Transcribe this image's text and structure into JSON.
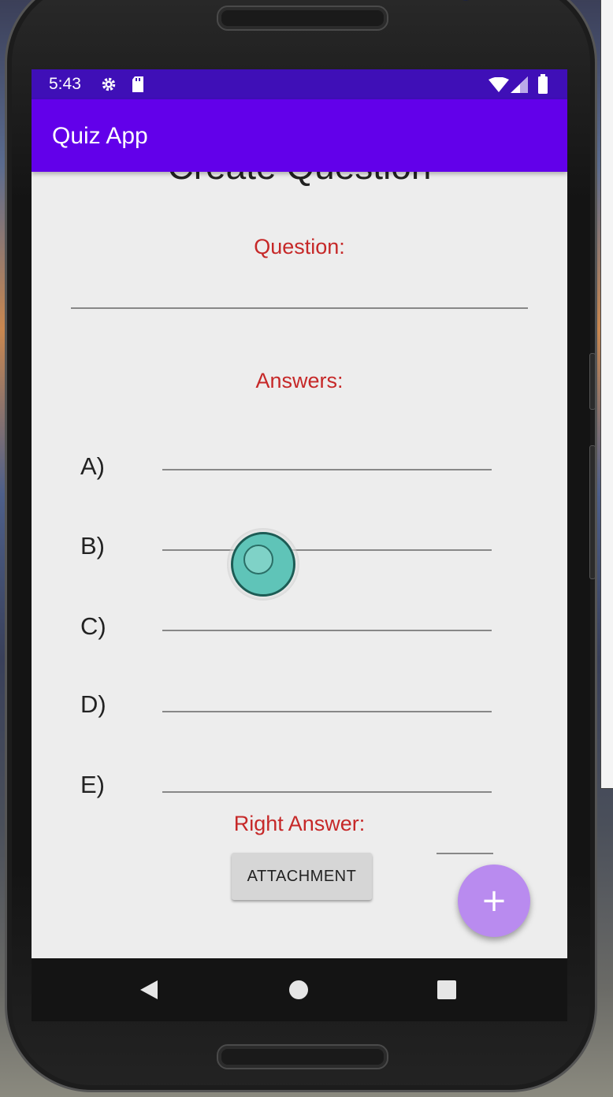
{
  "status_bar": {
    "time": "5:43",
    "icons": [
      "gear-icon",
      "sd-card-icon",
      "wifi-icon",
      "signal-icon",
      "battery-icon"
    ]
  },
  "app_bar": {
    "title": "Quiz App"
  },
  "form": {
    "page_title": "Create Question",
    "question_label": "Question:",
    "question_value": "",
    "answers_label": "Answers:",
    "options": [
      {
        "label": "A)",
        "value": ""
      },
      {
        "label": "B)",
        "value": ""
      },
      {
        "label": "C)",
        "value": ""
      },
      {
        "label": "D)",
        "value": ""
      },
      {
        "label": "E)",
        "value": ""
      }
    ],
    "right_answer_label": "Right Answer:",
    "right_answer_value": "",
    "attachment_button": "ATTACHMENT",
    "fab_symbol": "+"
  },
  "nav_bar": {
    "buttons": [
      "back-icon",
      "home-icon",
      "recents-icon"
    ]
  },
  "colors": {
    "status_bar": "#3f0fb7",
    "app_bar": "#6200ea",
    "label_red": "#c62828",
    "fab": "#b98bef",
    "background": "#ededed"
  }
}
